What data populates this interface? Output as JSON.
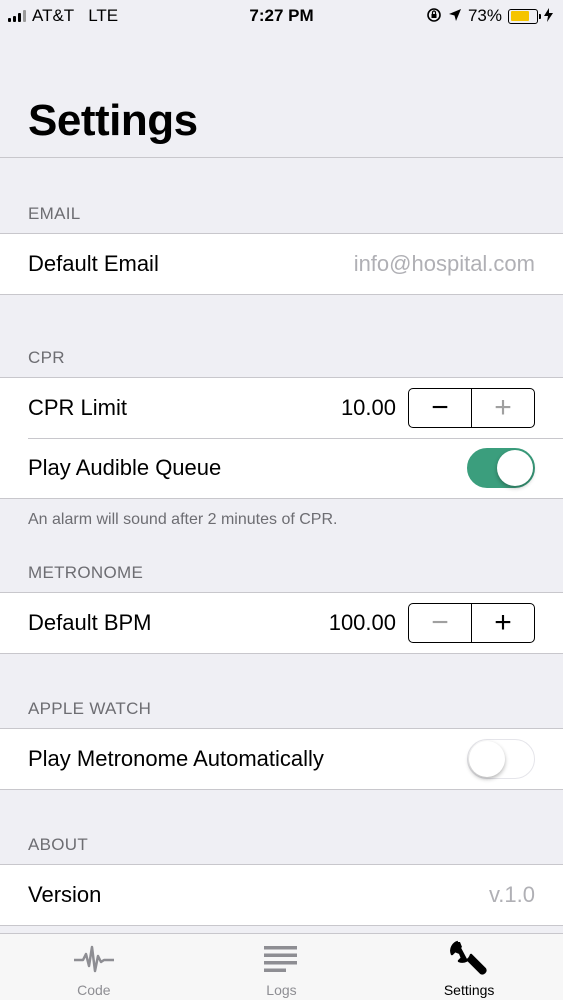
{
  "status_bar": {
    "carrier": "AT&T",
    "network": "LTE",
    "time": "7:27 PM",
    "battery_percent": "73%",
    "battery_level": 0.73,
    "icons": [
      "signal-icon",
      "rotation-lock-icon",
      "location-icon",
      "battery-icon",
      "charging-icon"
    ]
  },
  "page": {
    "title": "Settings"
  },
  "sections": {
    "email": {
      "header": "EMAIL",
      "default_email_label": "Default Email",
      "default_email_value": "info@hospital.com"
    },
    "cpr": {
      "header": "CPR",
      "limit_label": "CPR Limit",
      "limit_value": "10.00",
      "stepper_minus": "−",
      "stepper_plus": "+",
      "audible_label": "Play Audible Queue",
      "audible_on": true,
      "footer": "An alarm will sound after 2 minutes of CPR."
    },
    "metronome": {
      "header": "METRONOME",
      "bpm_label": "Default BPM",
      "bpm_value": "100.00",
      "stepper_minus": "−",
      "stepper_plus": "+"
    },
    "apple_watch": {
      "header": "APPLE WATCH",
      "auto_label": "Play Metronome Automatically",
      "auto_on": false
    },
    "about": {
      "header": "ABOUT",
      "version_label": "Version",
      "version_value": "v.1.0"
    }
  },
  "tab_bar": {
    "tabs": [
      {
        "label": "Code",
        "icon": "heartbeat-icon",
        "active": false
      },
      {
        "label": "Logs",
        "icon": "list-lines-icon",
        "active": false
      },
      {
        "label": "Settings",
        "icon": "wrench-icon",
        "active": true
      }
    ]
  },
  "colors": {
    "accent_toggle": "#3b9e7d",
    "battery_fill": "#f5c400",
    "background": "#efeff4",
    "section_text": "#6d6d72"
  }
}
